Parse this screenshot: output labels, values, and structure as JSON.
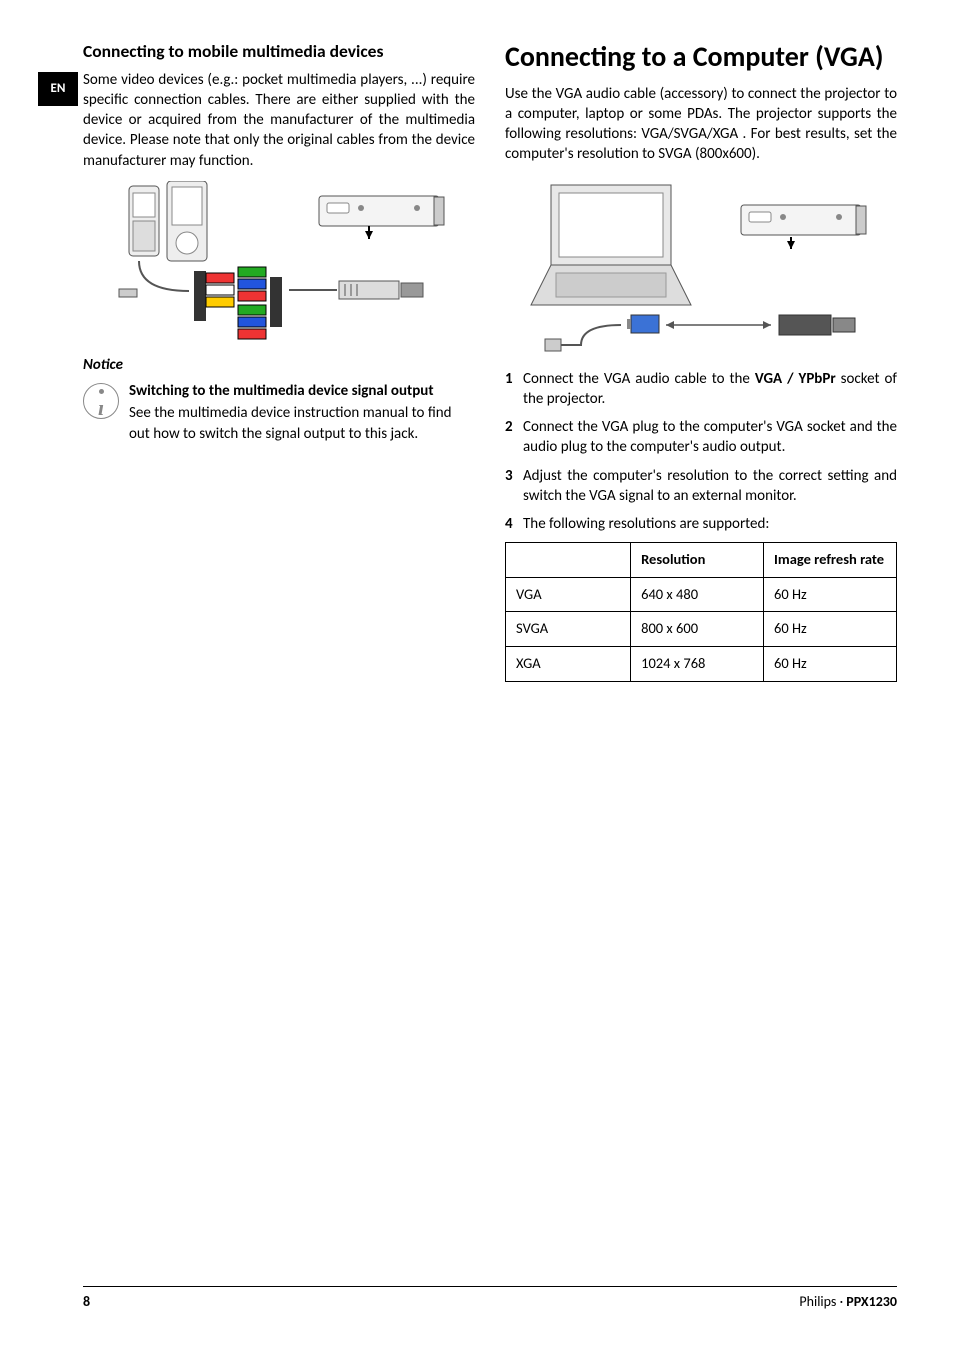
{
  "lang_tab": "EN",
  "left": {
    "heading": "Connecting to mobile multimedia devices",
    "intro": "Some video devices (e.g.: pocket multimedia players, ...) require specific connection cables. There are either supplied with the device or acquired from the manufacturer of the multimedia device. Please note that only the original cables from the device manufacturer may function.",
    "notice_label": "Notice",
    "notice_title": "Switching to the multimedia device signal output",
    "notice_body": "See the multimedia device instruction manual to find out how to switch the signal output to this jack.",
    "icon_name": "info-icon"
  },
  "right": {
    "heading": "Connecting to a Computer (VGA)",
    "intro": "Use the VGA audio cable (accessory) to connect the projector to a computer, laptop or some PDAs. The projector supports the following resolutions: VGA/SVGA/XGA . For best results, set the computer's resolution to SVGA (800x600).",
    "steps": [
      {
        "pre": "Connect the VGA audio cable to the ",
        "bold": "VGA / YPbPr",
        "post": " socket of the projector."
      },
      {
        "pre": "Connect the VGA plug to the computer's VGA socket and the audio plug to the computer's audio output.",
        "bold": "",
        "post": ""
      },
      {
        "pre": "Adjust the computer's resolution to the correct setting and switch the VGA signal to an external monitor.",
        "bold": "",
        "post": ""
      },
      {
        "pre": "The following resolutions are supported:",
        "bold": "",
        "post": ""
      }
    ],
    "table": {
      "headers": [
        "",
        "Resolution",
        "Image refresh rate"
      ],
      "rows": [
        [
          "VGA",
          "640 x 480",
          "60 Hz"
        ],
        [
          "SVGA",
          "800 x 600",
          "60 Hz"
        ],
        [
          "XGA",
          "1024 x 768",
          "60 Hz"
        ]
      ]
    }
  },
  "footer": {
    "page": "8",
    "brand": "Philips",
    "sep": " · ",
    "model": "PPX1230"
  }
}
